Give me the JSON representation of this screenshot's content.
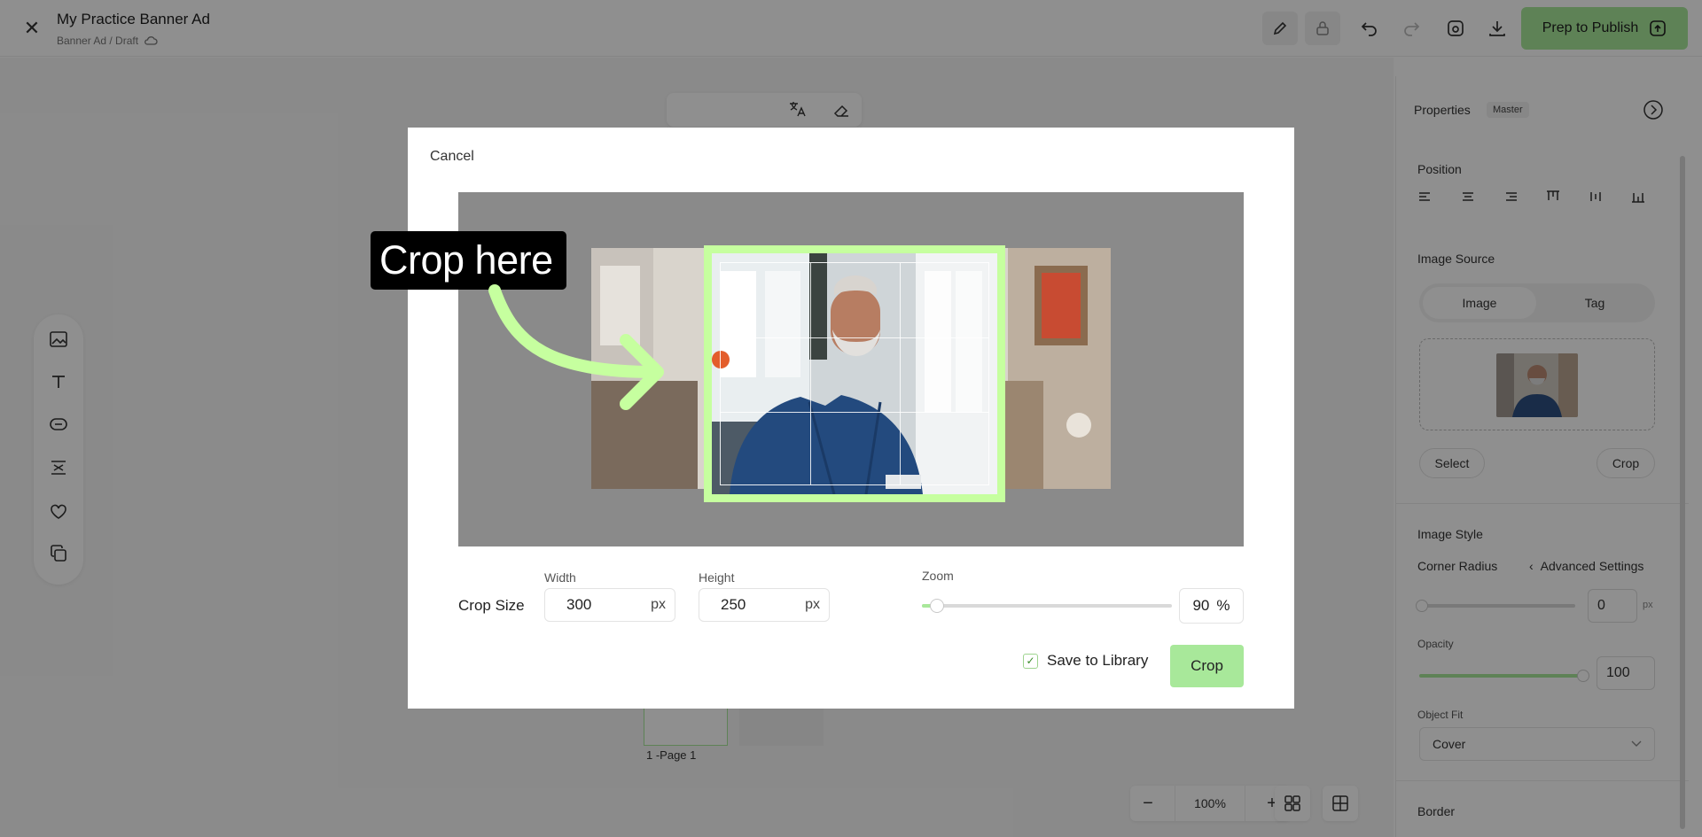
{
  "header": {
    "title": "My Practice Banner Ad",
    "breadcrumb": "Banner Ad / Draft",
    "publish_label": "Prep to Publish"
  },
  "canvas": {
    "page_label": "1 -Page 1",
    "zoom_level": "100%"
  },
  "properties": {
    "title": "Properties",
    "badge": "Master",
    "position_label": "Position",
    "image_source_label": "Image Source",
    "source_tabs": [
      "Image",
      "Tag"
    ],
    "select_label": "Select",
    "crop_label": "Crop",
    "image_style_label": "Image Style",
    "corner_radius_label": "Corner Radius",
    "advanced_label": "Advanced Settings",
    "corner_radius_value": "0",
    "corner_radius_unit": "px",
    "opacity_label": "Opacity",
    "opacity_value": "100",
    "object_fit_label": "Object Fit",
    "object_fit_value": "Cover",
    "border_label": "Border"
  },
  "crop_dialog": {
    "cancel_label": "Cancel",
    "crop_size_label": "Crop Size",
    "width_label": "Width",
    "width_value": "300",
    "height_label": "Height",
    "height_value": "250",
    "unit": "px",
    "zoom_label": "Zoom",
    "zoom_value": "90",
    "zoom_unit": "%",
    "zoom_fraction": 0.06,
    "save_to_library_label": "Save to Library",
    "save_to_library_checked": true,
    "crop_button_label": "Crop"
  },
  "callout": {
    "text": "Crop here"
  },
  "colors": {
    "accent": "#a8e89a",
    "crop_frame": "#c6ff9f",
    "callout_bg": "#000000"
  }
}
